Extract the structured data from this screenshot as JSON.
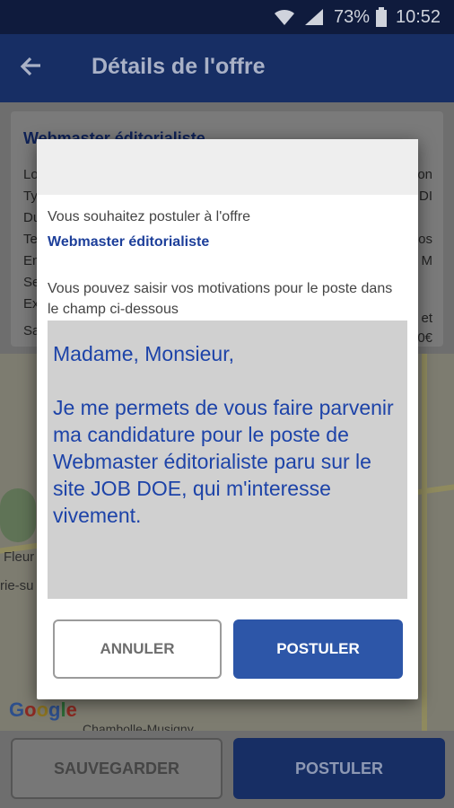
{
  "status_bar": {
    "battery_percent": "73%",
    "time": "10:52",
    "icons": [
      "wifi-icon",
      "signal-icon",
      "battery-icon"
    ]
  },
  "app_bar": {
    "title": "Détails de l'offre",
    "back_icon": "arrow-back-icon"
  },
  "card": {
    "title": "Webmaster éditorialiste",
    "rows": [
      "Lo",
      "Ty",
      "Du",
      "Te",
      "En",
      "Se",
      "Ex",
      "Sa"
    ],
    "values": [
      "on",
      "DI",
      "",
      "os",
      "M",
      "",
      "et",
      "0€"
    ]
  },
  "map": {
    "label1": "Fleur",
    "label2": "rie-su",
    "label3": "Chambolle-Musigny",
    "logo": [
      "G",
      "o",
      "o",
      "g",
      "l",
      "e"
    ]
  },
  "bottom_bar": {
    "save_label": "SAUVEGARDER",
    "apply_label": "POSTULER"
  },
  "dialog": {
    "intro": "Vous souhaitez postuler à l'offre",
    "offer_title": "Webmaster éditorialiste",
    "motivation_hint": "Vous pouvez saisir vos motivations pour le poste dans le champ ci-dessous",
    "motivation_text": "Madame, Monsieur,\n\nJe me permets de vous faire parvenir ma candidature pour le poste de Webmaster éditorialiste paru sur le site JOB DOE, qui m'interesse vivement.",
    "cancel_label": "ANNULER",
    "apply_label": "POSTULER"
  },
  "colors": {
    "primary": "#172e64",
    "accent": "#2d56a8",
    "link": "#1d3f9a"
  }
}
